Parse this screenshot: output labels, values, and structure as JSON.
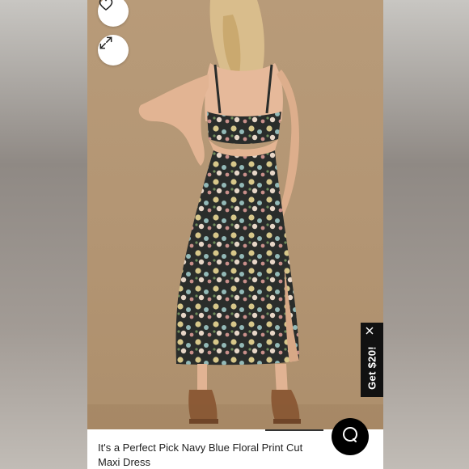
{
  "product": {
    "title_line1": "It's a Perfect Pick Navy Blue Floral Print Cut",
    "title_line2": "Maxi Dress"
  },
  "promo": {
    "label": "Get $20!"
  },
  "icons": {
    "favorite": "heart-icon",
    "expand": "expand-icon",
    "close": "close-icon",
    "chat": "chat-bubble-icon"
  },
  "colors": {
    "promo_bg": "#111111",
    "chat_bg": "#000000",
    "photo_bg": "#b39573"
  }
}
